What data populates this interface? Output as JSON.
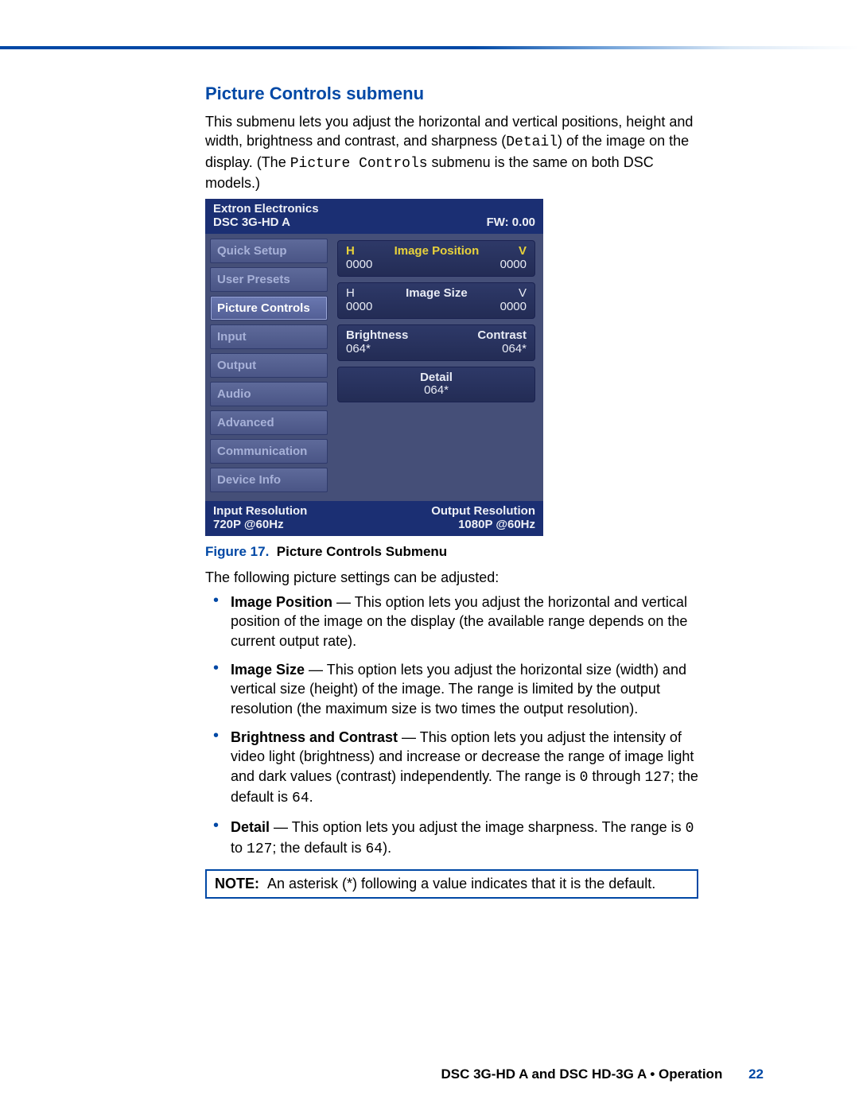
{
  "heading": "Picture Controls submenu",
  "intro": {
    "part1": "This submenu lets you adjust the horizontal and vertical positions, height and width, brightness and contrast, and sharpness (",
    "mono1": "Detail",
    "part2": ") of the image on the display. (The ",
    "mono2": "Picture Controls",
    "part3": " submenu is the same on both DSC models.)"
  },
  "osd": {
    "brand": "Extron Electronics",
    "model": "DSC 3G-HD A",
    "fw": "FW: 0.00",
    "side_items": [
      "Quick Setup",
      "User Presets",
      "Picture Controls",
      "Input",
      "Output",
      "Audio",
      "Advanced",
      "Communication",
      "Device Info"
    ],
    "active_index": 2,
    "panels": {
      "image_position": {
        "labelH": "H",
        "valH": "0000",
        "title": "Image Position",
        "labelV": "V",
        "valV": "0000"
      },
      "image_size": {
        "labelH": "H",
        "valH": "0000",
        "title": "Image Size",
        "labelV": "V",
        "valV": "0000"
      },
      "bc": {
        "left_label": "Brightness",
        "left_val": "064*",
        "right_label": "Contrast",
        "right_val": "064*"
      },
      "detail": {
        "title": "Detail",
        "val": "064*"
      }
    },
    "footer": {
      "in_label": "Input Resolution",
      "in_val": "720P @60Hz",
      "out_label": "Output Resolution",
      "out_val": "1080P @60Hz"
    }
  },
  "figure": {
    "no": "Figure 17.",
    "title": "Picture Controls Submenu"
  },
  "following": "The following picture settings can be adjusted:",
  "bullets": [
    {
      "term": "Image Position",
      "text": " — This option lets you adjust the horizontal and vertical position of the image on the display (the available range depends on the current output rate)."
    },
    {
      "term": "Image Size",
      "text": " — This option lets you adjust the horizontal size (width) and vertical size (height) of the image. The range is limited by the output resolution (the maximum size is two times the output resolution)."
    }
  ],
  "bullet_bc": {
    "term": "Brightness and Contrast",
    "pre": " — This option lets you adjust the intensity of video light (brightness) and increase or decrease the range of image light and dark values (contrast) independently. The range is ",
    "r0": "0",
    "mid": " through ",
    "r1": "127",
    "post": "; the default is ",
    "def": "64",
    "end": "."
  },
  "bullet_detail": {
    "term": "Detail",
    "pre": " — This option lets you adjust the image sharpness. The range is ",
    "r0": "0",
    "mid": " to ",
    "r1": "127",
    "post": "; the default is ",
    "def": "64",
    "end": ")."
  },
  "note": {
    "label": "NOTE:",
    "text": "An asterisk (*) following a value indicates that it is the default."
  },
  "page_footer": {
    "text": "DSC 3G-HD A and DSC HD-3G A • Operation",
    "page": "22"
  }
}
